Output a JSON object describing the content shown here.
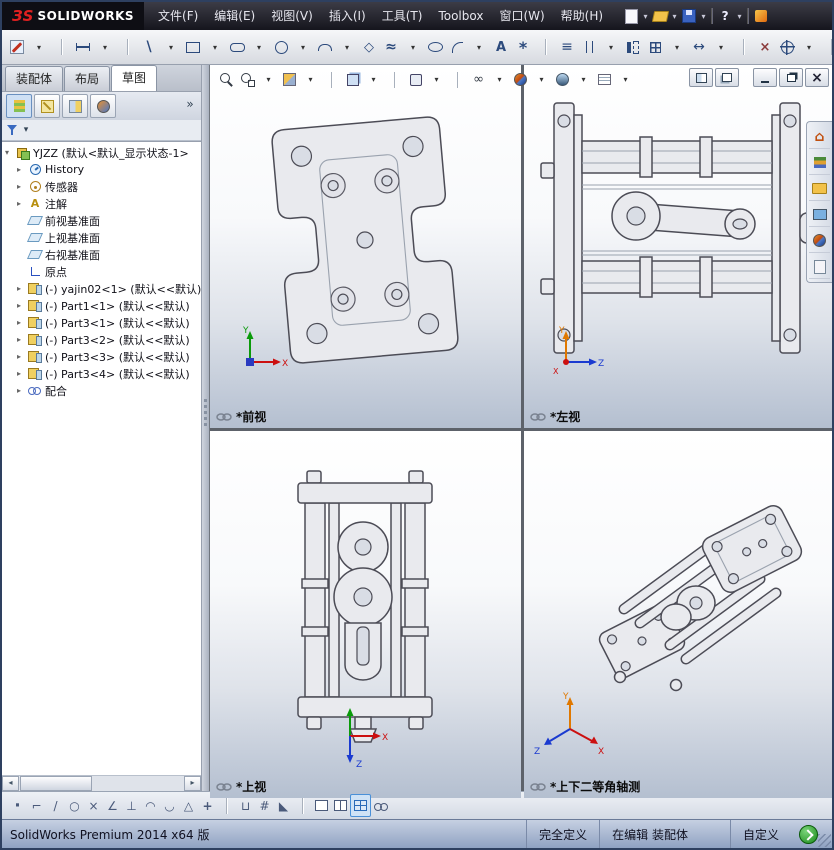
{
  "titlebar": {
    "logo_mark": "ЗS",
    "logo_text": "SOLIDWORKS",
    "menus": [
      {
        "name": "menu-file",
        "label": "文件(F)"
      },
      {
        "name": "menu-edit",
        "label": "编辑(E)"
      },
      {
        "name": "menu-view",
        "label": "视图(V)"
      },
      {
        "name": "menu-insert",
        "label": "插入(I)"
      },
      {
        "name": "menu-tools",
        "label": "工具(T)"
      },
      {
        "name": "menu-toolbox",
        "label": "Toolbox"
      },
      {
        "name": "menu-window",
        "label": "窗口(W)"
      },
      {
        "name": "menu-help",
        "label": "帮助(H)"
      }
    ],
    "quick_icons": [
      "new-document-icon",
      "caret-icon",
      "open-icon",
      "caret-icon",
      "save-icon",
      "caret-icon",
      "separator",
      "help-icon",
      "caret-icon",
      "separator",
      "resources-icon"
    ]
  },
  "sketch_toolbar": {
    "icons": [
      "sketch-icon",
      "caret-icon",
      "separator",
      "smart-dimension-icon",
      "caret-icon",
      "separator",
      "line-icon",
      "caret-icon",
      "rectangle-icon",
      "caret-icon",
      "slot-icon",
      "caret-icon",
      "circle-icon",
      "caret-icon",
      "arc-icon",
      "caret-icon",
      "polygon-icon",
      "spline-icon",
      "caret-icon",
      "ellipse-icon",
      "fillet-icon",
      "caret-icon",
      "text-icon",
      "point-icon",
      "separator",
      "convert-icon",
      "offset-icon",
      "caret-icon",
      "mirror-icon",
      "pattern-icon",
      "caret-icon",
      "move-icon",
      "caret-icon",
      "separator",
      "trim-icon",
      "spacer",
      "snap-icon",
      "caret-icon",
      "separator",
      "grid-settings-icon",
      "caret-icon",
      "separator",
      "sketch-picture-icon"
    ]
  },
  "command_tabs": [
    {
      "name": "tab-assembly",
      "label": "装配体",
      "active": false
    },
    {
      "name": "tab-layout",
      "label": "布局",
      "active": false
    },
    {
      "name": "tab-sketch",
      "label": "草图",
      "active": true
    }
  ],
  "feature_tree": {
    "panel_tabs": [
      "featuremanager-icon",
      "propertymanager-icon",
      "configurationmanager-icon",
      "displaymanager-icon"
    ],
    "expand_button": "»",
    "items": [
      {
        "name": "tree-root-assembly",
        "icon": "assembly-icon",
        "label": "YJZZ (默认<默认_显示状态-1>",
        "arrow": "▾",
        "indent": 0
      },
      {
        "name": "tree-item-history",
        "icon": "history-icon",
        "label": "History",
        "arrow": "▸",
        "indent": 1
      },
      {
        "name": "tree-item-sensors",
        "icon": "sensors-icon",
        "label": "传感器",
        "arrow": "▸",
        "indent": 1
      },
      {
        "name": "tree-item-annotations",
        "icon": "annotations-icon",
        "label": "注解",
        "arrow": "▸",
        "indent": 1
      },
      {
        "name": "tree-item-front-plane",
        "icon": "plane-icon",
        "label": "前视基准面",
        "arrow": "",
        "indent": 1
      },
      {
        "name": "tree-item-top-plane",
        "icon": "plane-icon",
        "label": "上视基准面",
        "arrow": "",
        "indent": 1
      },
      {
        "name": "tree-item-right-plane",
        "icon": "plane-icon",
        "label": "右视基准面",
        "arrow": "",
        "indent": 1
      },
      {
        "name": "tree-item-origin",
        "icon": "origin-icon",
        "label": "原点",
        "arrow": "",
        "indent": 1
      },
      {
        "name": "tree-item-yajin02-1",
        "icon": "part-icon",
        "label": "(-) yajin02<1> (默认<<默认)",
        "arrow": "▸",
        "indent": 1
      },
      {
        "name": "tree-item-part1-1",
        "icon": "part-icon",
        "label": "(-) Part1<1> (默认<<默认)",
        "arrow": "▸",
        "indent": 1
      },
      {
        "name": "tree-item-part3-1",
        "icon": "part-icon",
        "label": "(-) Part3<1> (默认<<默认)",
        "arrow": "▸",
        "indent": 1
      },
      {
        "name": "tree-item-part3-2",
        "icon": "part-icon",
        "label": "(-) Part3<2> (默认<<默认)",
        "arrow": "▸",
        "indent": 1
      },
      {
        "name": "tree-item-part3-3",
        "icon": "part-icon",
        "label": "(-) Part3<3> (默认<<默认)",
        "arrow": "▸",
        "indent": 1
      },
      {
        "name": "tree-item-part3-4",
        "icon": "part-icon",
        "label": "(-) Part3<4> (默认<<默认)",
        "arrow": "▸",
        "indent": 1
      },
      {
        "name": "tree-item-mates",
        "icon": "mates-icon",
        "label": "配合",
        "arrow": "▸",
        "indent": 1
      }
    ]
  },
  "viewports": {
    "headsup_icons": [
      "zoom-fit-icon",
      "zoom-area-icon",
      "caret-icon",
      "section-view-icon",
      "caret-icon",
      "separator",
      "view-orientation-icon",
      "caret-icon",
      "separator",
      "display-style-icon",
      "caret-icon",
      "separator",
      "hide-show-icon",
      "caret-icon",
      "appearances-icon",
      "caret-icon",
      "scene-icon",
      "caret-icon",
      "view-settings-icon",
      "caret-icon"
    ],
    "views": [
      {
        "name": "viewport-front",
        "label": "*前视"
      },
      {
        "name": "viewport-left",
        "label": "*左视"
      },
      {
        "name": "viewport-top",
        "label": "*上视"
      },
      {
        "name": "viewport-isometric",
        "label": "*上下二等角轴测"
      }
    ],
    "axis": {
      "x": "X",
      "y": "Y",
      "z": "Z"
    }
  },
  "taskpane": {
    "icons": [
      "home-icon",
      "design-library-icon",
      "file-explorer-icon",
      "view-palette-icon",
      "appearances-pane-icon",
      "custom-properties-icon"
    ]
  },
  "snap_toolbar": {
    "icons": [
      "pointer-dot-icon",
      "snap-corner-icon",
      "snap-line-icon",
      "snap-circle-icon",
      "snap-intersection-icon",
      "snap-angle-icon",
      "snap-perpendicular-icon",
      "snap-arc-icon",
      "snap-tangent-icon",
      "snap-midpoint-icon",
      "snap-hv-icon",
      "separator",
      "snap-length-icon",
      "snap-grid-icon",
      "snap-angle2-icon",
      "separator",
      "single-view-icon",
      "two-view-icon",
      "four-view-icon",
      "link-views-icon"
    ]
  },
  "statusbar": {
    "product": "SolidWorks Premium 2014 x64 版",
    "define_state": "完全定义",
    "editing_state": "在编辑 装配体",
    "custom_label": "自定义"
  }
}
